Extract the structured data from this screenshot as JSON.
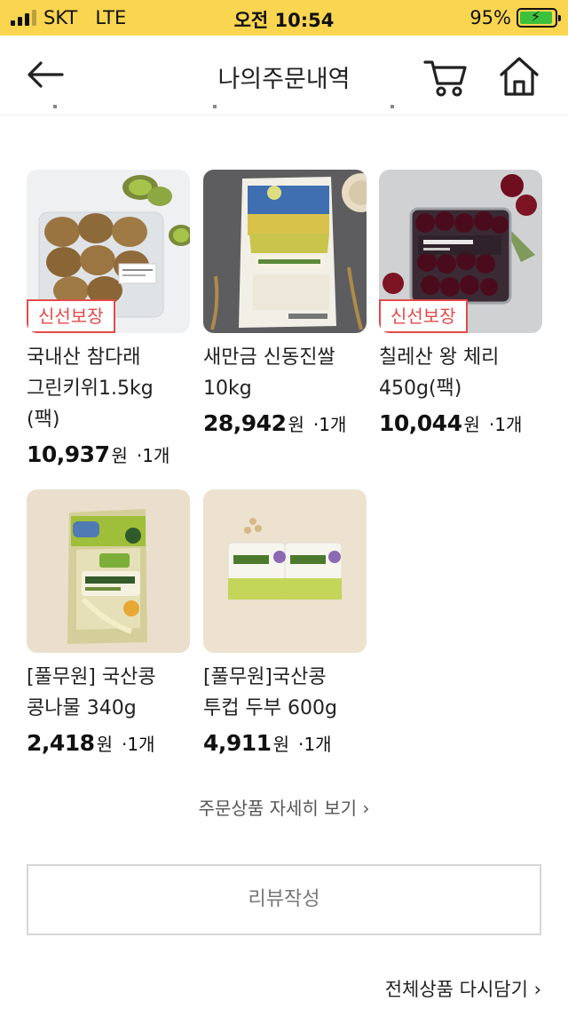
{
  "status_bar": {
    "carrier": "SKT",
    "network": "LTE",
    "time": "오전 10:54",
    "battery": "95%",
    "battery_level": 0.95
  },
  "header": {
    "title": "나의주문내역",
    "back_icon": "arrow-left-icon",
    "cart_icon": "cart-icon",
    "home_icon": "home-icon"
  },
  "products": [
    {
      "name": "국내산 참다래 그린키위1.5kg (팩)",
      "price": "10,937",
      "currency": "원",
      "qty": "·1개",
      "badge": "신선보장"
    },
    {
      "name": "새만금 신동진쌀 10kg",
      "price": "28,942",
      "currency": "원",
      "qty": "·1개"
    },
    {
      "name": "칠레산 왕 체리 450g(팩)",
      "price": "10,044",
      "currency": "원",
      "qty": "·1개",
      "badge": "신선보장"
    },
    {
      "name": "[풀무원] 국산콩 콩나물 340g",
      "price": "2,418",
      "currency": "원",
      "qty": "·1개"
    },
    {
      "name": "[풀무원]국산콩 투컵 두부 600g",
      "price": "4,911",
      "currency": "원",
      "qty": "·1개"
    }
  ],
  "actions": {
    "detail_link": "주문상품 자세히 보기 ›",
    "review_button": "리뷰작성",
    "readd_link": "전체상품 다시담기 ›"
  },
  "colors": {
    "status_bar_bg": "#fad550",
    "badge_red": "#e24b4b",
    "battery_green": "#3cc13c"
  }
}
